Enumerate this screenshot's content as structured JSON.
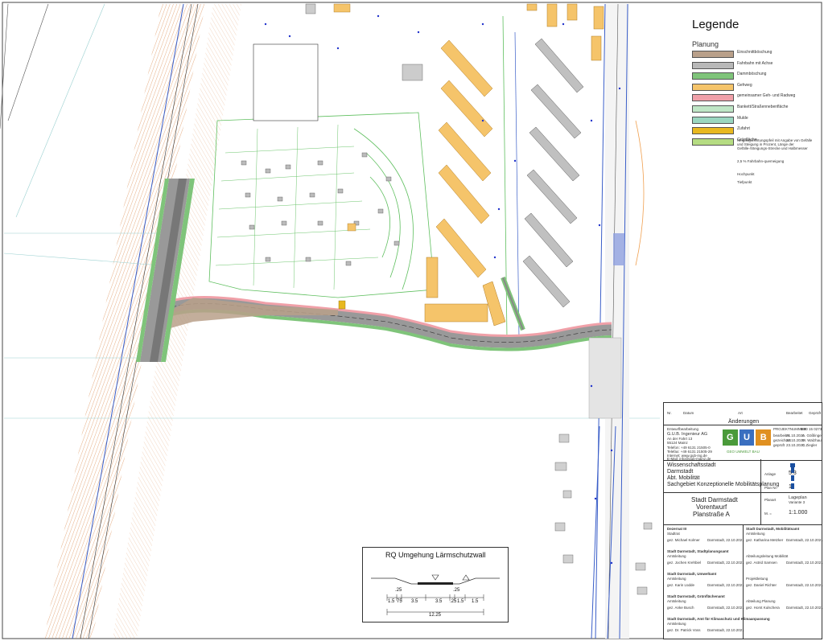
{
  "legend": {
    "title": "Legende",
    "section": "Planung",
    "items": [
      {
        "label": "Einschnittböschung",
        "color": "#b9a08a"
      },
      {
        "label": "Fahrbahn mit Achse",
        "color": "#b8b8b8"
      },
      {
        "label": "Dammböschung",
        "color": "#7fc47a"
      },
      {
        "label": "Gehweg",
        "color": "#f5c46a"
      },
      {
        "label": "gemeinsamer Geh- und Radweg",
        "color": "#f0a0a8"
      },
      {
        "label": "Bankett/Straßennebenfläche",
        "color": "#bfe6c6"
      },
      {
        "label": "Mulde",
        "color": "#9ad6c0"
      },
      {
        "label": "Zufahrt",
        "color": "#e8b820"
      },
      {
        "label": "Grünfläche",
        "color": "#b5dc82"
      }
    ],
    "symbols": [
      {
        "label": "Neigungsrichtungspfeil mit Angabe von Gefälle und Steigung in Prozent, Länge der Gefälle-/Steigungs-Strecke und Halbmesser"
      },
      {
        "label": "2,5 % Fahrbahn-quemeigung"
      },
      {
        "label": "Hochpunkt"
      },
      {
        "label": "Tiefpunkt"
      }
    ]
  },
  "changes": {
    "col_nr": "Nr.",
    "col_datum": "Datum",
    "col_art": "Art",
    "col_bearbeitet": "Bearbeitet",
    "col_geprueft": "Geprüft",
    "heading": "Änderungen"
  },
  "engineer": {
    "label": "Entwurfbearbeitung",
    "company": "G.U.B. Ingenieur AG",
    "street": "An der Fahrt 13",
    "city": "55124 Mainz",
    "phone": "Telefon: +49 6131 21505-0",
    "fax": "Telefax: +49 6131 21505-29",
    "web": "Internet: www.gub-ing.de",
    "email": "E-Mail: info@gub-mainz.de",
    "logo": "GUB",
    "logo_sub": "GEO UMWELT BAU",
    "project_no_label": "PROJEKTNUMMER",
    "project_no": "M20 15 0273",
    "rows": [
      {
        "role": "bearbeitet",
        "date": "21.10.2020",
        "name": "A. Gößlinger"
      },
      {
        "role": "gezeichnet",
        "date": "22.10.2020",
        "name": "M. Walzhauf"
      },
      {
        "role": "geprüft",
        "date": "23.10.2020",
        "name": "C.Ziegler"
      }
    ]
  },
  "client": {
    "lines": [
      "Wissenschaftsstadt",
      "Darmstadt",
      "Abt. Mobilität",
      "Sachgebiet Konzeptionelle Mobilitätsplanung"
    ],
    "fields": [
      {
        "label": "Anlage",
        "value": "5.3"
      },
      {
        "label": "Plan Nr.",
        "value": "1"
      },
      {
        "label": "Planart",
        "value": "Lageplan"
      },
      {
        "label": "M. =",
        "value": "1:1.000"
      }
    ],
    "variant": "Variante 3"
  },
  "project": {
    "lines": [
      "Stadt Darmstadt",
      "Vorentwurf",
      "Planstraße A"
    ]
  },
  "signatures": {
    "left": [
      {
        "office": "Dezernat III",
        "sub": "Stadtrat",
        "name": "gez. Michael Kolmer",
        "date": "Darmstadt, 22.10.2021"
      },
      {
        "office": "Stadt Darmstadt, Stadtplanungsamt",
        "sub": "Amtsleitung",
        "name": "gez. Jochen Krehbiel",
        "date": "Darmstadt, 22.10.2021"
      },
      {
        "office": "Stadt Darmstadt, Umweltamt",
        "sub": "Amtsleitung",
        "name": "gez. Karin Lüdde",
        "date": "Darmstadt, 22.10.2021"
      },
      {
        "office": "Stadt Darmstadt, Grünflächenamt",
        "sub": "Amtsleitung",
        "name": "gez. Anke Busch",
        "date": "Darmstadt, 22.10.2021"
      },
      {
        "office": "Stadt Darmstadt, Amt für Klimaschutz und Klimaanpassung",
        "sub": "Amtsleitung",
        "name": "gez. Dr. Patrick Voss",
        "date": "Darmstadt, 22.10.2021"
      }
    ],
    "right": [
      {
        "office": "Stadt Darmstadt, Mobilitätsamt",
        "sub": "Amtsleitung",
        "name": "gez. Katharina Metzker",
        "date": "Darmstadt, 22.10.2021"
      },
      {
        "office": "",
        "sub": "Abteilungsleitung Mobilität",
        "name": "gez. Astrid Samsen",
        "date": "Darmstadt, 22.10.2021"
      },
      {
        "office": "",
        "sub": "Projektleitung",
        "name": "gez. Daniel Richter",
        "date": "Darmstadt, 22.10.2021"
      },
      {
        "office": "",
        "sub": "Abteilung Planung",
        "name": "gez. Horst Kulschera",
        "date": "Darmstadt, 22.10.2021"
      }
    ]
  },
  "cross_section": {
    "title": "RQ Umgehung Lärmschutzwall",
    "dims": [
      "1.5",
      "75",
      "3.5",
      "3.5",
      ".25",
      "1.5",
      "1.5"
    ],
    "upper_labels": [
      ".25",
      ".25"
    ],
    "total": "12.25"
  }
}
